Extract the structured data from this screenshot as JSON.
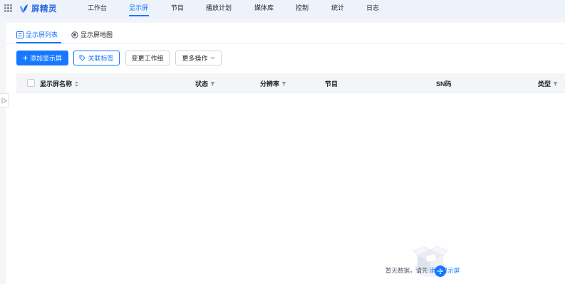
{
  "app": {
    "logo_text": "屏精灵",
    "brand_color": "#1677ff"
  },
  "nav": {
    "items": [
      {
        "label": "工作台",
        "active": false
      },
      {
        "label": "显示屏",
        "active": true
      },
      {
        "label": "节目",
        "active": false
      },
      {
        "label": "播放计划",
        "active": false
      },
      {
        "label": "媒体库",
        "active": false
      },
      {
        "label": "控制",
        "active": false
      },
      {
        "label": "统计",
        "active": false
      },
      {
        "label": "日志",
        "active": false
      }
    ]
  },
  "subtabs": [
    {
      "label": "显示屏列表",
      "icon": "list-icon",
      "active": true
    },
    {
      "label": "显示屏地图",
      "icon": "map-icon",
      "active": false
    }
  ],
  "toolbar": {
    "add_label": "添加显示屏",
    "add_icon": "plus-icon",
    "tag_label": "关联标签",
    "tag_icon": "tag-icon",
    "group_label": "变更工作组",
    "more_label": "更多操作",
    "more_icon": "chevron-down-icon"
  },
  "table": {
    "columns": [
      {
        "label": "显示屏名称",
        "icon": "sort-icon"
      },
      {
        "label": "状态",
        "icon": "filter-icon"
      },
      {
        "label": "分辨率",
        "icon": "filter-icon"
      },
      {
        "label": "节目",
        "icon": ""
      },
      {
        "label": "SN码",
        "icon": ""
      },
      {
        "label": "类型",
        "icon": "filter-icon"
      }
    ],
    "rows": []
  },
  "empty_state": {
    "text": "暂无数据，请先",
    "link": "添加显示屏",
    "icon": "empty-box-add-icon"
  },
  "sidebar": {
    "collapse_icon": "expand-sidebar-icon"
  }
}
